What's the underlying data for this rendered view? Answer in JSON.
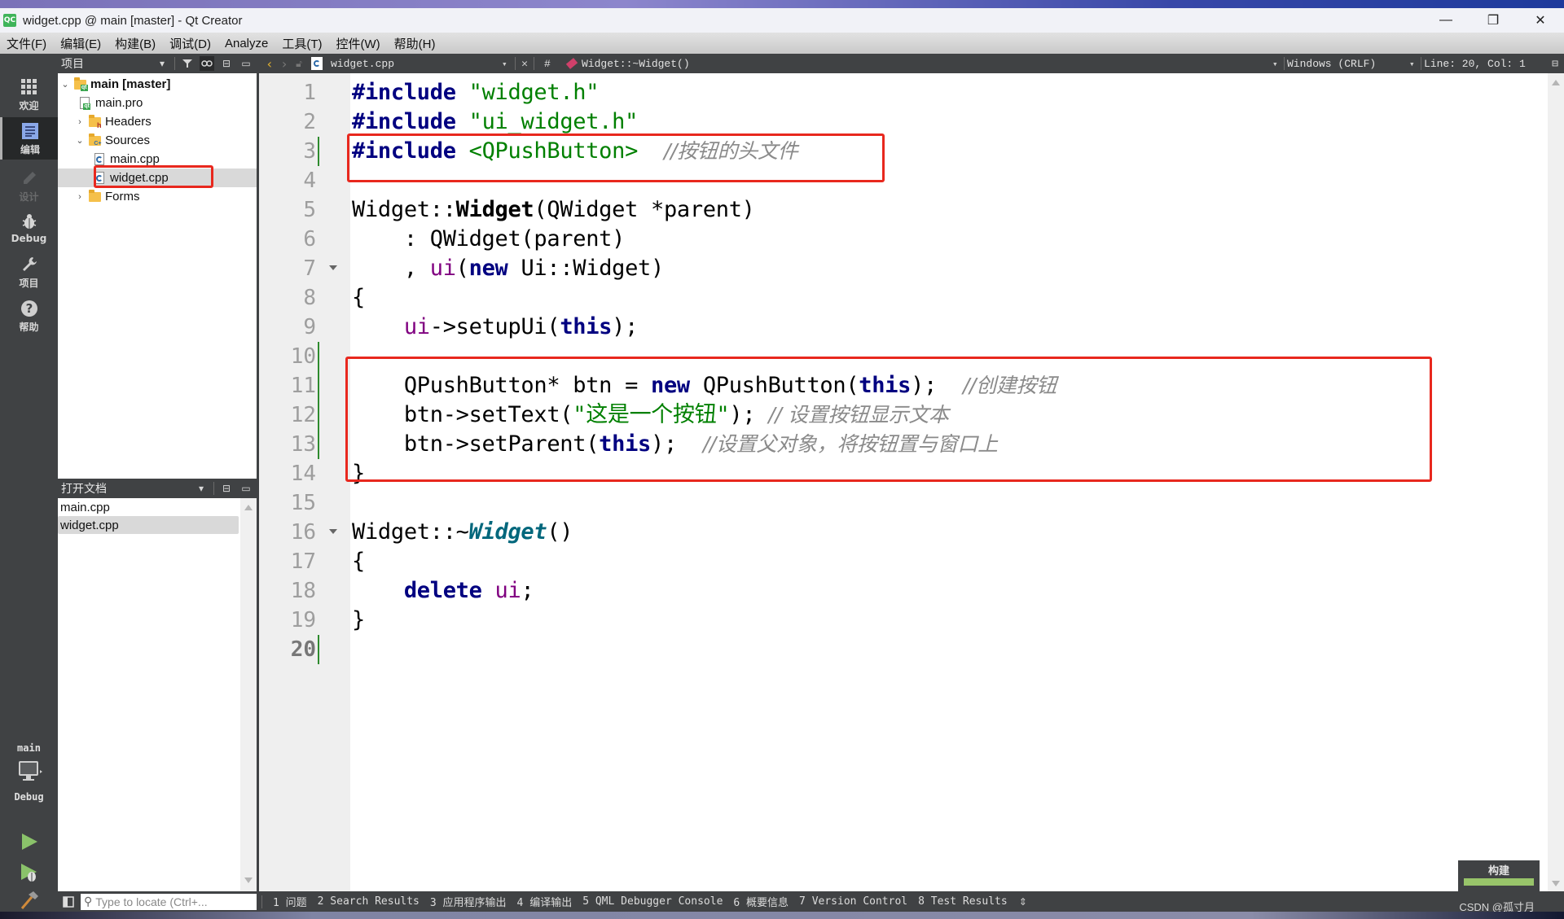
{
  "window": {
    "title": "widget.cpp @ main [master] - Qt Creator",
    "logo_text": "QC",
    "controls": {
      "minimize": "—",
      "maximize": "❐",
      "close": "✕"
    }
  },
  "menu": [
    "文件(F)",
    "编辑(E)",
    "构建(B)",
    "调试(D)",
    "Analyze",
    "工具(T)",
    "控件(W)",
    "帮助(H)"
  ],
  "modes": [
    {
      "label": "欢迎",
      "icon": "welcome-grid-icon",
      "active": false
    },
    {
      "label": "编辑",
      "icon": "edit-icon",
      "active": true
    },
    {
      "label": "设计",
      "icon": "design-pencil-icon",
      "active": false,
      "disabled": true
    },
    {
      "label": "Debug",
      "icon": "debug-bug-icon",
      "active": false
    },
    {
      "label": "项目",
      "icon": "projects-wrench-icon",
      "active": false
    },
    {
      "label": "帮助",
      "icon": "help-icon",
      "active": false
    }
  ],
  "kit": {
    "project": "main",
    "build_config": "Debug"
  },
  "project_panel": {
    "title": "项目",
    "tree": [
      {
        "label": "main [master]",
        "type": "project",
        "expanded": true,
        "depth": 0,
        "bold": true
      },
      {
        "label": "main.pro",
        "type": "pro-file",
        "depth": 1
      },
      {
        "label": "Headers",
        "type": "folder-h",
        "expanded": false,
        "depth": 1
      },
      {
        "label": "Sources",
        "type": "folder-cpp",
        "expanded": true,
        "depth": 1
      },
      {
        "label": "main.cpp",
        "type": "cpp-file",
        "depth": 2
      },
      {
        "label": "widget.cpp",
        "type": "cpp-file",
        "depth": 2,
        "selected": true
      },
      {
        "label": "Forms",
        "type": "folder-forms",
        "expanded": false,
        "depth": 1
      }
    ]
  },
  "open_docs": {
    "title": "打开文档",
    "items": [
      {
        "label": "main.cpp",
        "selected": false
      },
      {
        "label": "widget.cpp",
        "selected": true
      }
    ]
  },
  "editor_bar": {
    "file": "widget.cpp",
    "symbol_hash": "#",
    "symbol": "Widget::~Widget()",
    "line_endings": "Windows (CRLF)",
    "cursor": "Line: 20, Col: 1"
  },
  "code": {
    "current_line": 20,
    "lines": [
      {
        "n": "1",
        "html": "<span class='kw-pre'>#include</span> <span class='str'>\"widget.h\"</span>"
      },
      {
        "n": "2",
        "html": "<span class='kw-pre'>#include</span> <span class='str'>\"ui_widget.h\"</span>"
      },
      {
        "n": "3",
        "html": "<span class='kw-pre'>#include</span> <span class='str'>&lt;QPushButton&gt;</span>  <span class='cmt'>//按钮的头文件</span>",
        "changed": true
      },
      {
        "n": "4",
        "html": ""
      },
      {
        "n": "5",
        "html": "Widget::<span class='fn-bold'>Widget</span>(QWidget *parent)"
      },
      {
        "n": "6",
        "html": "    : QWidget(parent)"
      },
      {
        "n": "7",
        "html": "    , <span class='mem'>ui</span>(<span class='kw'>new</span> Ui::Widget)",
        "fold": true
      },
      {
        "n": "8",
        "html": "{"
      },
      {
        "n": "9",
        "html": "    <span class='mem'>ui</span>-&gt;setupUi(<span class='kw'>this</span>);"
      },
      {
        "n": "10",
        "html": "",
        "changed": true
      },
      {
        "n": "11",
        "html": "    QPushButton* btn = <span class='kw'>new</span> QPushButton(<span class='kw'>this</span>);  <span class='cmt'>//创建按钮</span>",
        "changed": true
      },
      {
        "n": "12",
        "html": "    btn-&gt;setText(<span class='str'>\"这是一个按钮\"</span>); <span class='cmt'>// 设置按钮显示文本</span>",
        "changed": true
      },
      {
        "n": "13",
        "html": "    btn-&gt;setParent(<span class='kw'>this</span>);  <span class='cmt'>//设置父对象，将按钮置与窗口上</span>",
        "changed": true
      },
      {
        "n": "14",
        "html": "}"
      },
      {
        "n": "15",
        "html": ""
      },
      {
        "n": "16",
        "html": "Widget::~<span class='fn-italic'>Widget</span>()",
        "fold": true
      },
      {
        "n": "17",
        "html": "{"
      },
      {
        "n": "18",
        "html": "    <span class='kw'>delete</span> <span class='mem'>ui</span>;"
      },
      {
        "n": "19",
        "html": "}"
      },
      {
        "n": "20",
        "html": "",
        "changed": true
      }
    ]
  },
  "build": {
    "label": "构建",
    "progress": 1.0,
    "color": "#98c46a"
  },
  "statusbar": {
    "locator_placeholder": "Type to locate (Ctrl+...",
    "tabs": [
      "1 问题",
      "2 Search Results",
      "3 应用程序输出",
      "4 编译输出",
      "5 QML Debugger Console",
      "6 概要信息",
      "7 Version Control",
      "8 Test Results"
    ],
    "more": "⇕"
  },
  "watermark": "CSDN @孤寸月",
  "colors": {
    "highlight_box": "#e8281e",
    "change_marker": "#2e8b2e",
    "keyword": "#000080",
    "string": "#008000",
    "member": "#800080"
  }
}
